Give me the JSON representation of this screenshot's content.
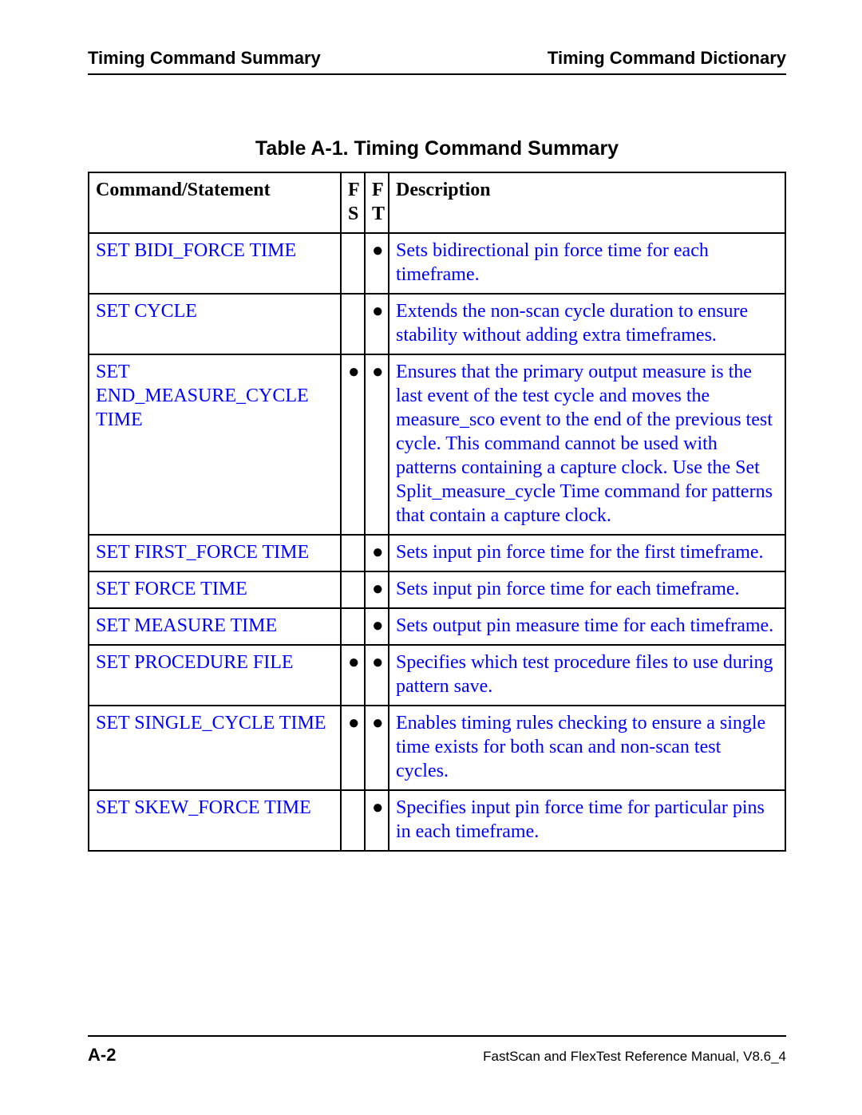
{
  "header": {
    "left": "Timing Command Summary",
    "right": "Timing Command Dictionary"
  },
  "table": {
    "caption": "Table A-1. Timing Command Summary",
    "head": {
      "cmd": "Command/Statement",
      "fs_top": "F",
      "fs_bot": "S",
      "ft_top": "F",
      "ft_bot": "T",
      "desc": "Description"
    },
    "rows": [
      {
        "cmd": "SET BIDI_FORCE TIME",
        "fs": "",
        "ft": "●",
        "desc": "Sets bidirectional pin force time for each timeframe."
      },
      {
        "cmd": "SET CYCLE",
        "fs": "",
        "ft": "●",
        "desc": "Extends the non-scan cycle duration to ensure stability without adding extra timeframes."
      },
      {
        "cmd": "SET END_MEASURE_CYCLE TIME",
        "fs": "●",
        "ft": "●",
        "desc": "Ensures that the primary output measure is the last event of the test cycle and moves the measure_sco event to the end of the previous test cycle. This command cannot be used with patterns containing a capture clock. Use the Set Split_measure_cycle Time command for patterns that contain a capture clock."
      },
      {
        "cmd": "SET FIRST_FORCE TIME",
        "fs": "",
        "ft": "●",
        "desc": "Sets input pin force time for the first timeframe."
      },
      {
        "cmd": "SET FORCE TIME",
        "fs": "",
        "ft": "●",
        "desc": "Sets input pin force time for each timeframe."
      },
      {
        "cmd": "SET MEASURE TIME",
        "fs": "",
        "ft": "●",
        "desc": "Sets output pin measure time for each timeframe."
      },
      {
        "cmd": "SET PROCEDURE FILE",
        "fs": "●",
        "ft": "●",
        "desc": "Specifies which test procedure files to use during pattern save."
      },
      {
        "cmd": "SET SINGLE_CYCLE TIME",
        "fs": "●",
        "ft": "●",
        "desc": "Enables timing rules checking to ensure a single time exists for both scan and non-scan test cycles."
      },
      {
        "cmd": "SET SKEW_FORCE TIME",
        "fs": "",
        "ft": "●",
        "desc": "Specifies input pin force time for particular pins in each timeframe."
      }
    ]
  },
  "footer": {
    "page": "A-2",
    "manual": "FastScan and FlexTest Reference Manual, V8.6_4"
  }
}
